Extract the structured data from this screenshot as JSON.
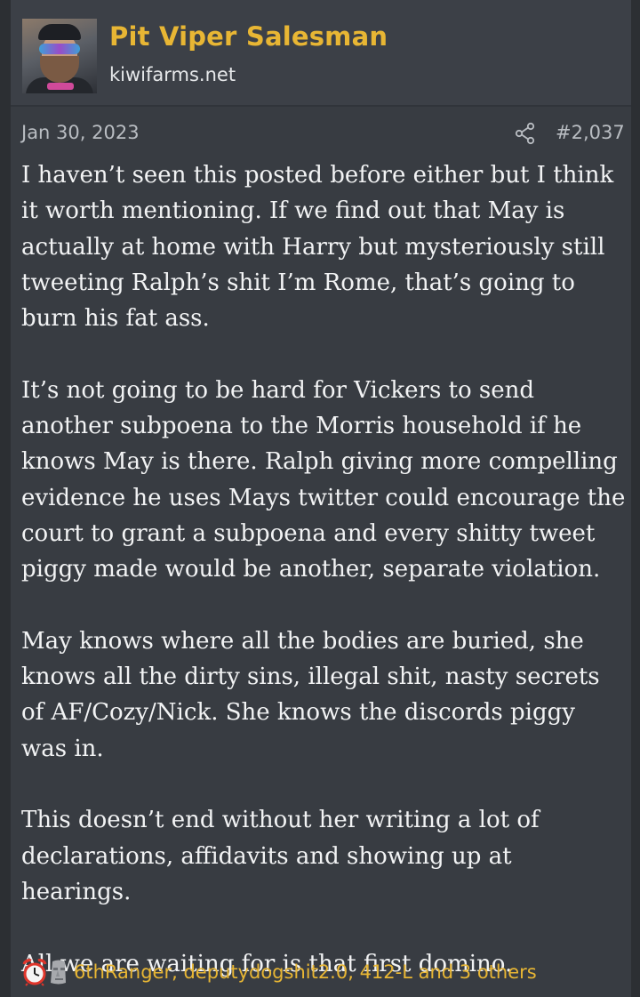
{
  "user": {
    "name": "Pit Viper Salesman",
    "site": "kiwifarms.net"
  },
  "post": {
    "date": "Jan 30, 2023",
    "number": "#2,037",
    "paragraphs": [
      "I haven’t seen this posted before either but I think it worth mentioning. If we find out that May is actually at home with Harry but mysteriously still tweeting Ralph’s shit I’m Rome, that’s going to burn his fat ass.",
      "It’s not going to be hard for Vickers to send another subpoena to the Morris household if he knows May is there. Ralph giving more compelling evidence he uses Mays twitter could encourage the court to grant a subpoena and every shitty tweet piggy made would be another, separate violation.",
      "May knows where all the bodies are buried, she knows all the dirty sins, illegal shit, nasty secrets of AF/Cozy/Nick. She knows the discords piggy was in.",
      "This doesn’t end without her writing a lot of declarations, affidavits and showing up at hearings.",
      "All we are waiting for is that first domino."
    ]
  },
  "reactions": {
    "icons": [
      "alarm-clock-icon",
      "moai-icon"
    ],
    "users_text": "6thRanger, deputydogshit2.0, 412-L and 3 others"
  },
  "colors": {
    "username": "#e8b634",
    "background": "#383c42",
    "text": "#f2f3f4",
    "meta": "#b9bdc2"
  }
}
